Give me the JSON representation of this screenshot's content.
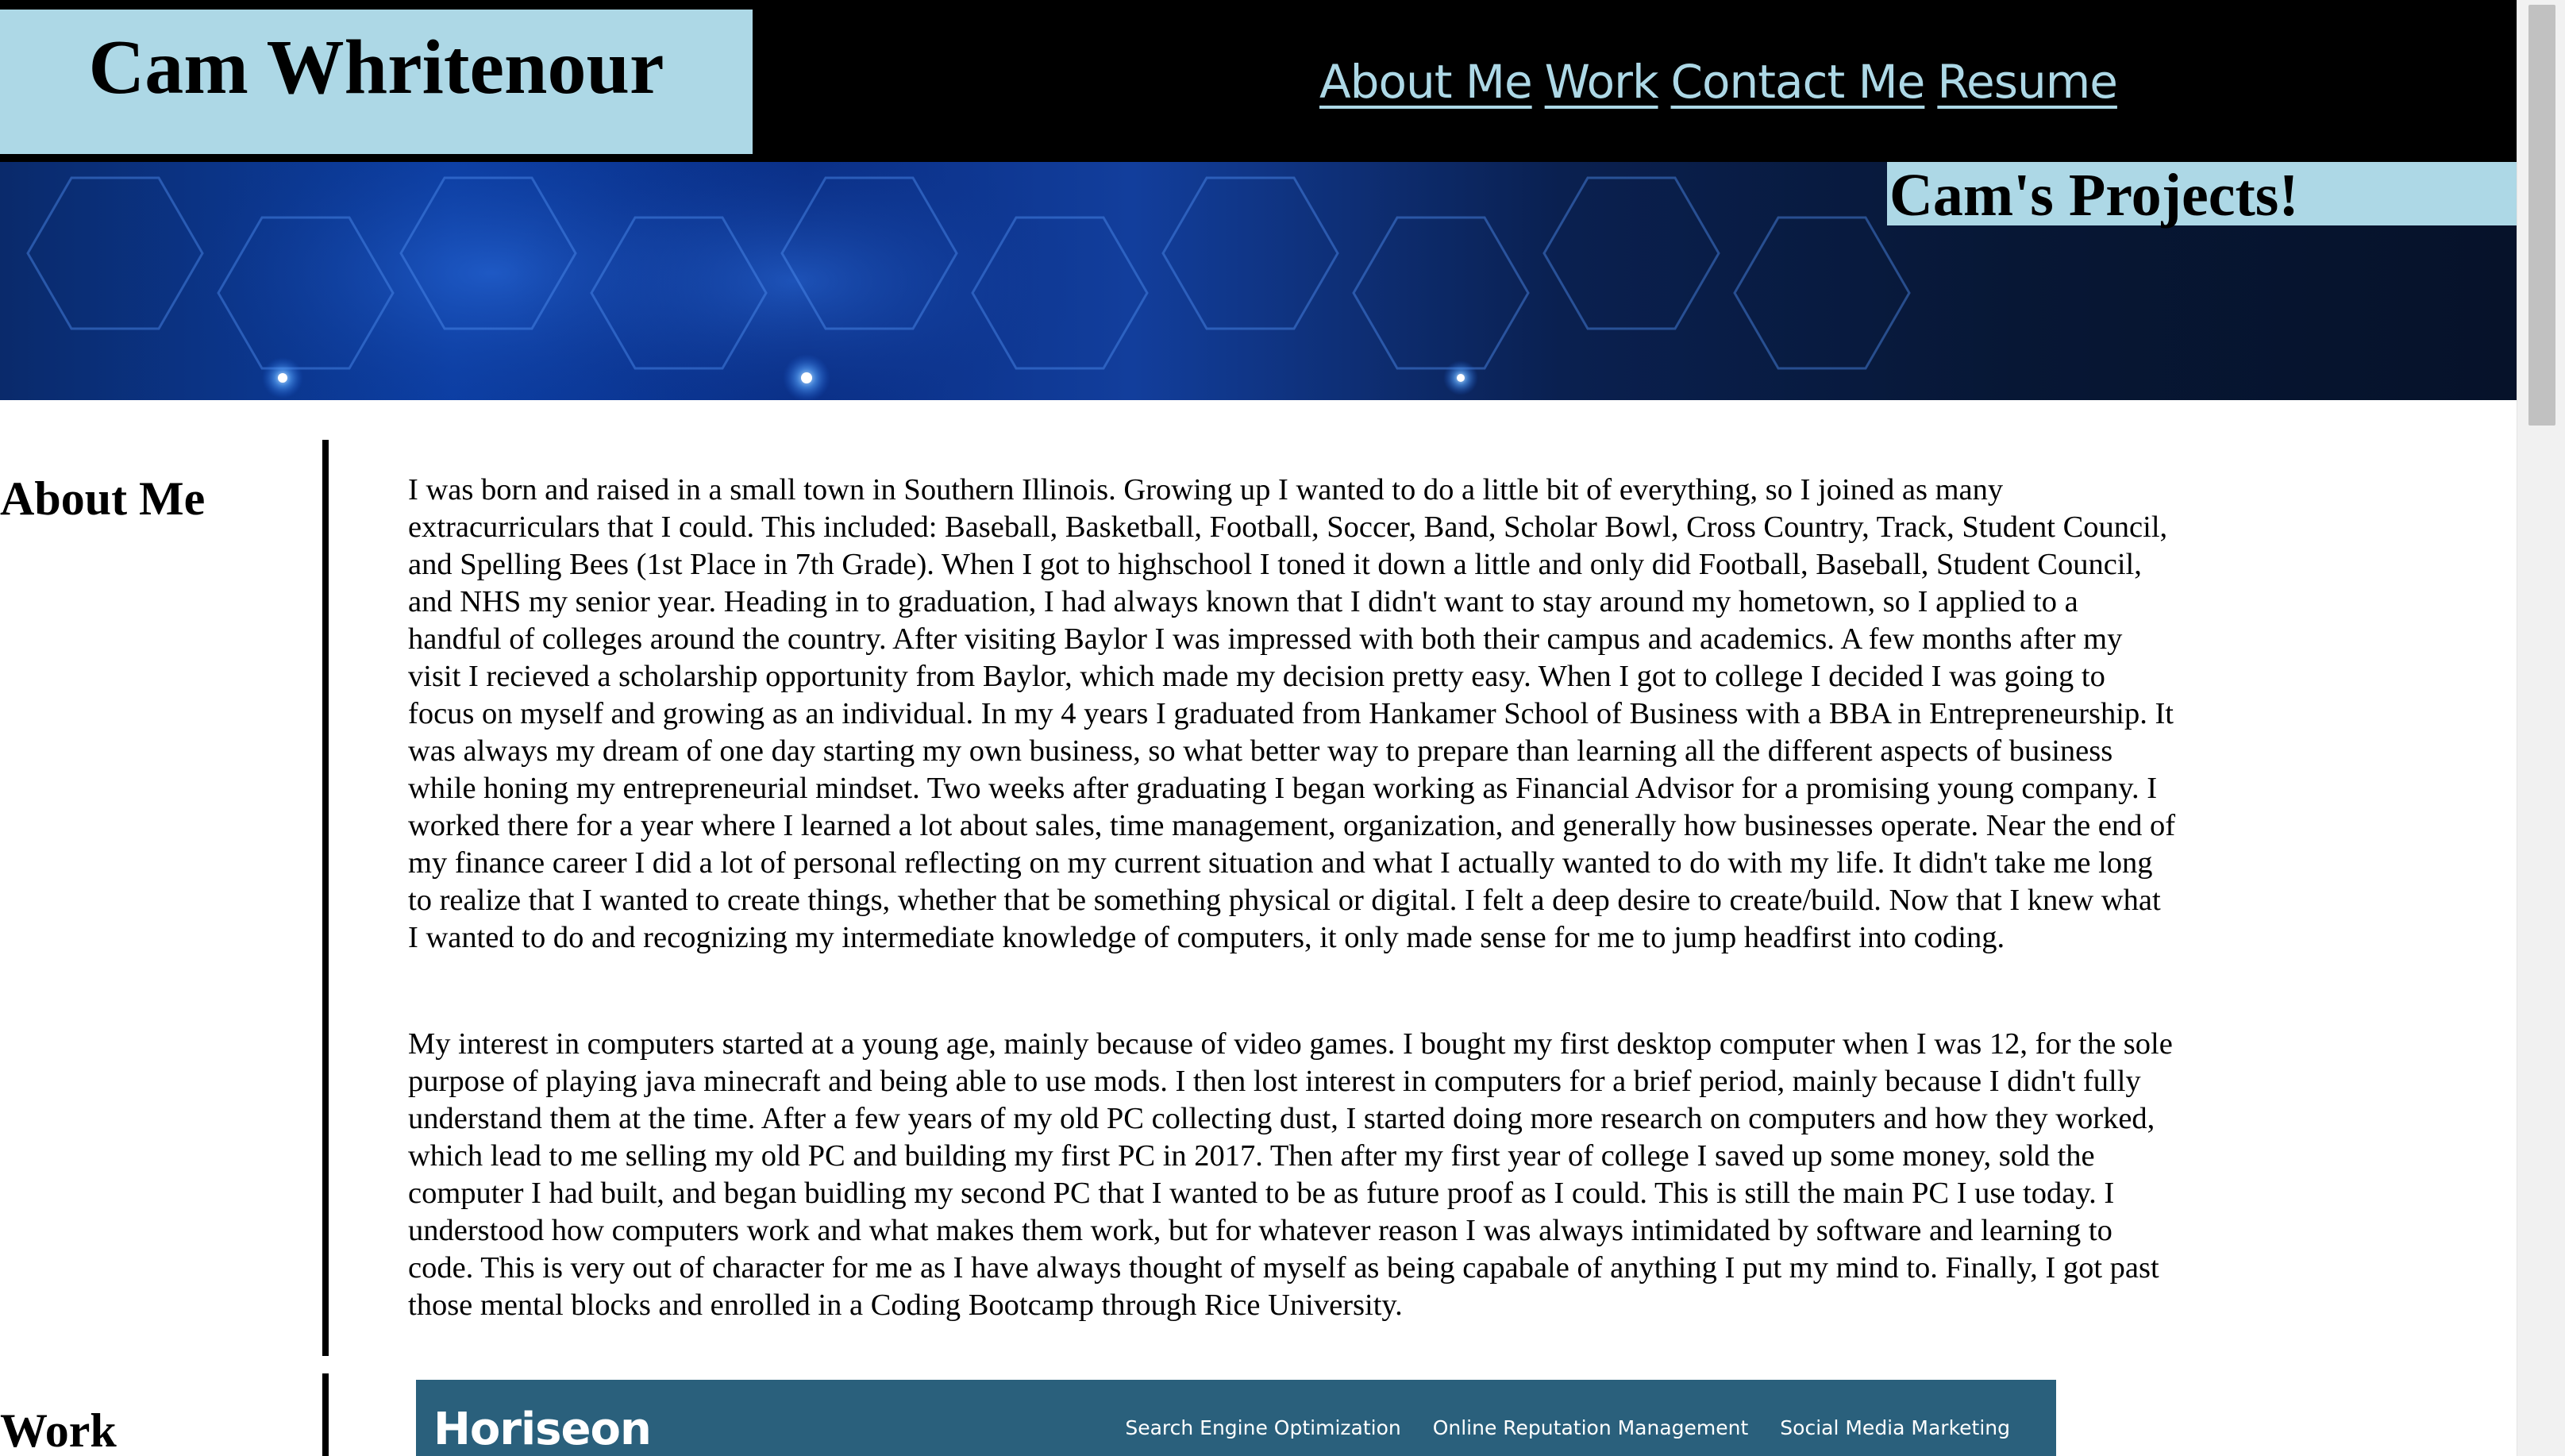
{
  "header": {
    "brand": "Cam Whritenour",
    "nav": [
      {
        "label": "About Me"
      },
      {
        "label": "Work"
      },
      {
        "label": "Contact Me"
      },
      {
        "label": "Resume"
      }
    ]
  },
  "hero": {
    "title": "Cam's Projects!"
  },
  "about": {
    "heading": "About Me",
    "paragraphs": [
      "I was born and raised in a small town in Southern Illinois. Growing up I wanted to do a little bit of everything, so I joined as many extracurriculars that I could. This included: Baseball, Basketball, Football, Soccer, Band, Scholar Bowl, Cross Country, Track, Student Council, and Spelling Bees (1st Place in 7th Grade). When I got to highschool I toned it down a little and only did Football, Baseball, Student Council, and NHS my senior year. Heading in to graduation, I had always known that I didn't want to stay around my hometown, so I applied to a handful of colleges around the country. After visiting Baylor I was impressed with both their campus and academics. A few months after my visit I recieved a scholarship opportunity from Baylor, which made my decision pretty easy. When I got to college I decided I was going to focus on myself and growing as an individual. In my 4 years I graduated from Hankamer School of Business with a BBA in Entrepreneurship. It was always my dream of one day starting my own business, so what better way to prepare than learning all the different aspects of business while honing my entrepreneurial mindset. Two weeks after graduating I began working as Financial Advisor for a promising young company. I worked there for a year where I learned a lot about sales, time management, organization, and generally how businesses operate. Near the end of my finance career I did a lot of personal reflecting on my current situation and what I actually wanted to do with my life. It didn't take me long to realize that I wanted to create things, whether that be something physical or digital. I felt a deep desire to create/build. Now that I knew what I wanted to do and recognizing my intermediate knowledge of computers, it only made sense for me to jump headfirst into coding.",
      "My interest in computers started at a young age, mainly because of video games. I bought my first desktop computer when I was 12, for the sole purpose of playing java minecraft and being able to use mods. I then lost interest in computers for a brief period, mainly because I didn't fully understand them at the time. After a few years of my old PC collecting dust, I started doing more research on computers and how they worked, which lead to me selling my old PC and building my first PC in 2017. Then after my first year of college I saved up some money, sold the computer I had built, and began buidling my second PC that I wanted to be as future proof as I could. This is still the main PC I use today. I understood how computers work and what makes them work, but for whatever reason I was always intimidated by software and learning to code. This is very out of character for me as I have always thought of myself as being capabale of anything I put my mind to. Finally, I got past those mental blocks and enrolled in a Coding Bootcamp through Rice University."
    ]
  },
  "work": {
    "heading": "Work",
    "preview": {
      "brand": "Horiseon",
      "nav": [
        "Search Engine Optimization",
        "Online Reputation Management",
        "Social Media Marketing"
      ]
    }
  },
  "colors": {
    "accent": "#add8e6",
    "header_bg": "#000000",
    "preview_bg": "#2a607c"
  }
}
